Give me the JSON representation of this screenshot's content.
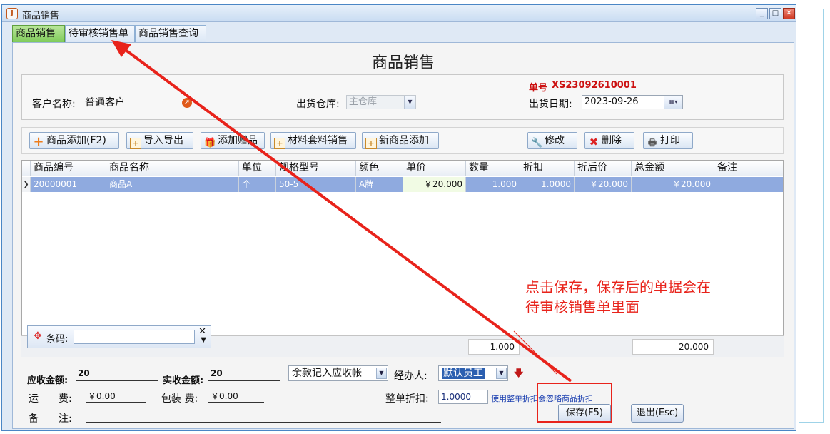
{
  "window": {
    "title": "商品销售",
    "controls": {
      "minimize": "_",
      "maximize": "□",
      "close": "✕"
    }
  },
  "tabs": [
    {
      "label": "商品销售",
      "active": true
    },
    {
      "label": "待审核销售单",
      "active": false
    },
    {
      "label": "商品销售查询",
      "active": false
    }
  ],
  "page": {
    "title": "商品销售"
  },
  "header": {
    "customer_label": "客户名称:",
    "customer_value": "普通客户",
    "warehouse_label": "出货仓库:",
    "warehouse_value": "主仓库",
    "order_no_label": "单号",
    "order_no_value": "XS23092610001",
    "date_label": "出货日期:",
    "date_value": "2023-09-26"
  },
  "toolbar": {
    "add_product": "商品添加(F2)",
    "import_export": "导入导出",
    "add_gift": "添加赠品",
    "material_sale": "材料套料销售",
    "new_product": "新商品添加",
    "edit": "修改",
    "delete": "删除",
    "print": "打印"
  },
  "grid": {
    "columns": [
      "商品编号",
      "商品名称",
      "单位",
      "规格型号",
      "颜色",
      "单价",
      "数量",
      "折扣",
      "折后价",
      "总金额",
      "备注"
    ],
    "rows": [
      {
        "code": "20000001",
        "name": "商品A",
        "unit": "个",
        "spec": "50-5",
        "color": "A牌",
        "price": "￥20.000",
        "qty": "1.000",
        "discount": "1.0000",
        "disc_price": "￥20.000",
        "total": "￥20.000",
        "note": ""
      }
    ],
    "footer_qty": "1.000",
    "footer_total": "20.000"
  },
  "barcode": {
    "label": "条码:",
    "value": ""
  },
  "bottom": {
    "receivable_label": "应收金额:",
    "receivable_value": "20",
    "received_label": "实收金额:",
    "received_value": "20",
    "balance_mode": "余款记入应收帐",
    "handler_label": "经办人:",
    "handler_value": "默认员工",
    "freight_label": "运　　费:",
    "freight_value": "￥0.00",
    "packing_label": "包装 费:",
    "packing_value": "￥0.00",
    "whole_discount_label": "整单折扣:",
    "whole_discount_value": "1.0000",
    "whole_discount_note": "使用整单折扣会忽略商品折扣",
    "remark_label": "备　　注:",
    "remark_value": "",
    "save_button": "保存(F5)",
    "exit_button": "退出(Esc)"
  },
  "annotation": {
    "line1": "点击保存，保存后的单据会在",
    "line2": "待审核销售单里面",
    "color": "#e8231b"
  }
}
